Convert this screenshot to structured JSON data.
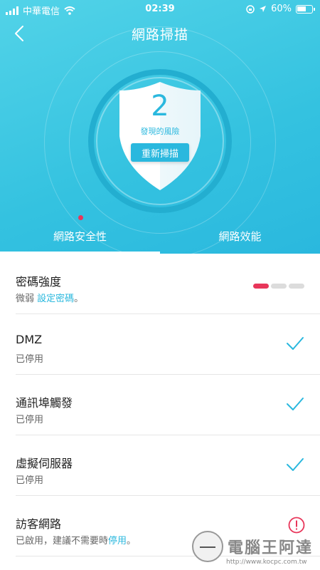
{
  "status_bar": {
    "carrier": "中華電信",
    "time": "02:39",
    "battery": "60%"
  },
  "header": {
    "title": "網路掃描",
    "back_icon": "chevron-left-icon"
  },
  "scan": {
    "risk_count": "2",
    "risk_label": "發現的風險",
    "rescan_label": "重新掃描"
  },
  "tabs": [
    {
      "label": "網路安全性",
      "active": true
    },
    {
      "label": "網路效能",
      "active": false
    }
  ],
  "items": [
    {
      "title": "密碼強度",
      "status": "微弱",
      "link": "設定密碼",
      "suffix": "。",
      "indicator": "strength",
      "strength_level": 1,
      "strength_total": 3
    },
    {
      "title": "DMZ",
      "status": "已停用",
      "indicator": "check-icon"
    },
    {
      "title": "通訊埠觸發",
      "status": "已停用",
      "indicator": "check-icon"
    },
    {
      "title": "虛擬伺服器",
      "status": "已停用",
      "indicator": "check-icon"
    },
    {
      "title": "訪客網路",
      "status": "已啟用，建議不需要時",
      "link": "停用",
      "suffix": "。",
      "indicator": "warning-icon"
    }
  ],
  "watermark": {
    "text": "電腦王阿達",
    "url": "http://www.kocpc.com.tw"
  },
  "colors": {
    "accent": "#2ab8de",
    "hero_start": "#52d3e8",
    "danger": "#e8365a"
  }
}
